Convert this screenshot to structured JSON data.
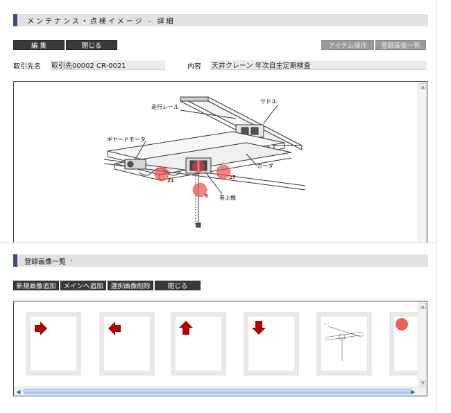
{
  "header": {
    "title": "メンテナンス・点検イメージ - 詳細"
  },
  "toolbar": {
    "edit": "編 集",
    "close": "閉じる",
    "item_ops": "アイテム操作",
    "image_list": "登録画像一覧"
  },
  "fields": {
    "client_label": "取引先名",
    "client_value": "取引先00002 CR-0021",
    "content_label": "内容",
    "content_value": "天井クレーン 年次自主定期検査"
  },
  "diagram": {
    "labels": {
      "rail": "走行レール",
      "saddle": "サドル",
      "gear_motor": "ギヤードモータ",
      "girder": "ガーダ",
      "hoist": "巻上機"
    },
    "markers": [
      {
        "id": "21"
      },
      {
        "id": "27"
      },
      {
        "id": "6"
      }
    ],
    "marker_color": "#e8453c"
  },
  "list_section": {
    "title": "登録画像一覧",
    "suffix": "-"
  },
  "list_toolbar": {
    "add_new": "新規画像追加",
    "add_main": "メインへ追加",
    "delete_selected": "選択画像削除",
    "close": "閉じる"
  },
  "thumbnails": [
    {
      "icon": "arrow-right-icon"
    },
    {
      "icon": "arrow-left-icon"
    },
    {
      "icon": "arrow-up-icon"
    },
    {
      "icon": "arrow-down-icon"
    },
    {
      "icon": "crane-diagram-thumbnail"
    },
    {
      "icon": "red-circle-icon"
    }
  ],
  "colors": {
    "accent": "#3b4f7e",
    "arrow": "#b00000",
    "button": "#3a3a3a"
  }
}
